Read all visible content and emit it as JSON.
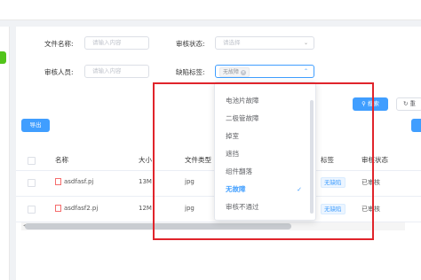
{
  "filter": {
    "filename_label": "文件名称:",
    "filename_placeholder": "请输入内容",
    "audit_status_label": "审核状态:",
    "audit_status_placeholder": "请选择",
    "auditor_label": "审核人员:",
    "auditor_placeholder": "请输入内容",
    "defect_label": "缺陷标签:",
    "defect_selected_tag": "无故障"
  },
  "buttons": {
    "search": "搜索",
    "reset": "重",
    "export": "导出"
  },
  "table": {
    "headers": [
      "名称",
      "大小",
      "文件类型",
      "标签",
      "审核状态"
    ],
    "rows": [
      {
        "name": "asdfasf.pj",
        "size": "13M",
        "type": "jpg",
        "tag": "无缺陷",
        "status": "已审核"
      },
      {
        "name": "asdfasf2.pj",
        "size": "12M",
        "type": "jpg",
        "tag": "无缺陷",
        "status": "已审核"
      }
    ]
  },
  "dropdown": {
    "items": [
      "电池片故障",
      "二极管故障",
      "掉室",
      "遮挡",
      "组件翻落",
      "无故障",
      "审核不通过"
    ],
    "selected": "无故障",
    "partial_top": "电池"
  },
  "colors": {
    "primary": "#409eff",
    "highlight": "#e0242b"
  }
}
